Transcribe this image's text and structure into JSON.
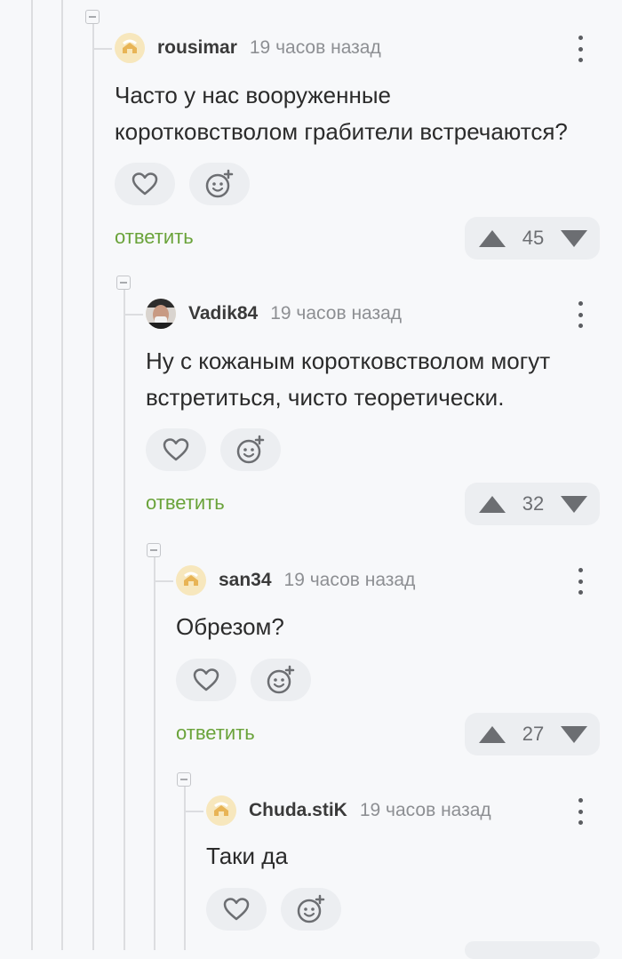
{
  "comments": [
    {
      "username": "rousimar",
      "time": "19 часов назад",
      "text_lines": [
        "Часто у нас вооруженные",
        "коротковстволом грабители встречаются?"
      ],
      "reply_label": "ответить",
      "score": "45",
      "avatar_icon": "default-avatar-icon"
    },
    {
      "username": "Vadik84",
      "time": "19 часов назад",
      "text_lines": [
        "Ну с кожаным коротковстволом могут",
        "встретиться, чисто теоретически."
      ],
      "reply_label": "ответить",
      "score": "32",
      "avatar_icon": "photo-avatar-icon"
    },
    {
      "username": "san34",
      "time": "19 часов назад",
      "text_lines": [
        "Обрезом?"
      ],
      "reply_label": "ответить",
      "score": "27",
      "avatar_icon": "default-avatar-icon"
    },
    {
      "username": "Chuda.stiK",
      "time": "19 часов назад",
      "text_lines": [
        "Таки да"
      ],
      "avatar_icon": "default-avatar-icon"
    }
  ],
  "colors": {
    "reply": "#6aa33a",
    "background": "#f7f8fa",
    "pill": "#eceef1"
  }
}
